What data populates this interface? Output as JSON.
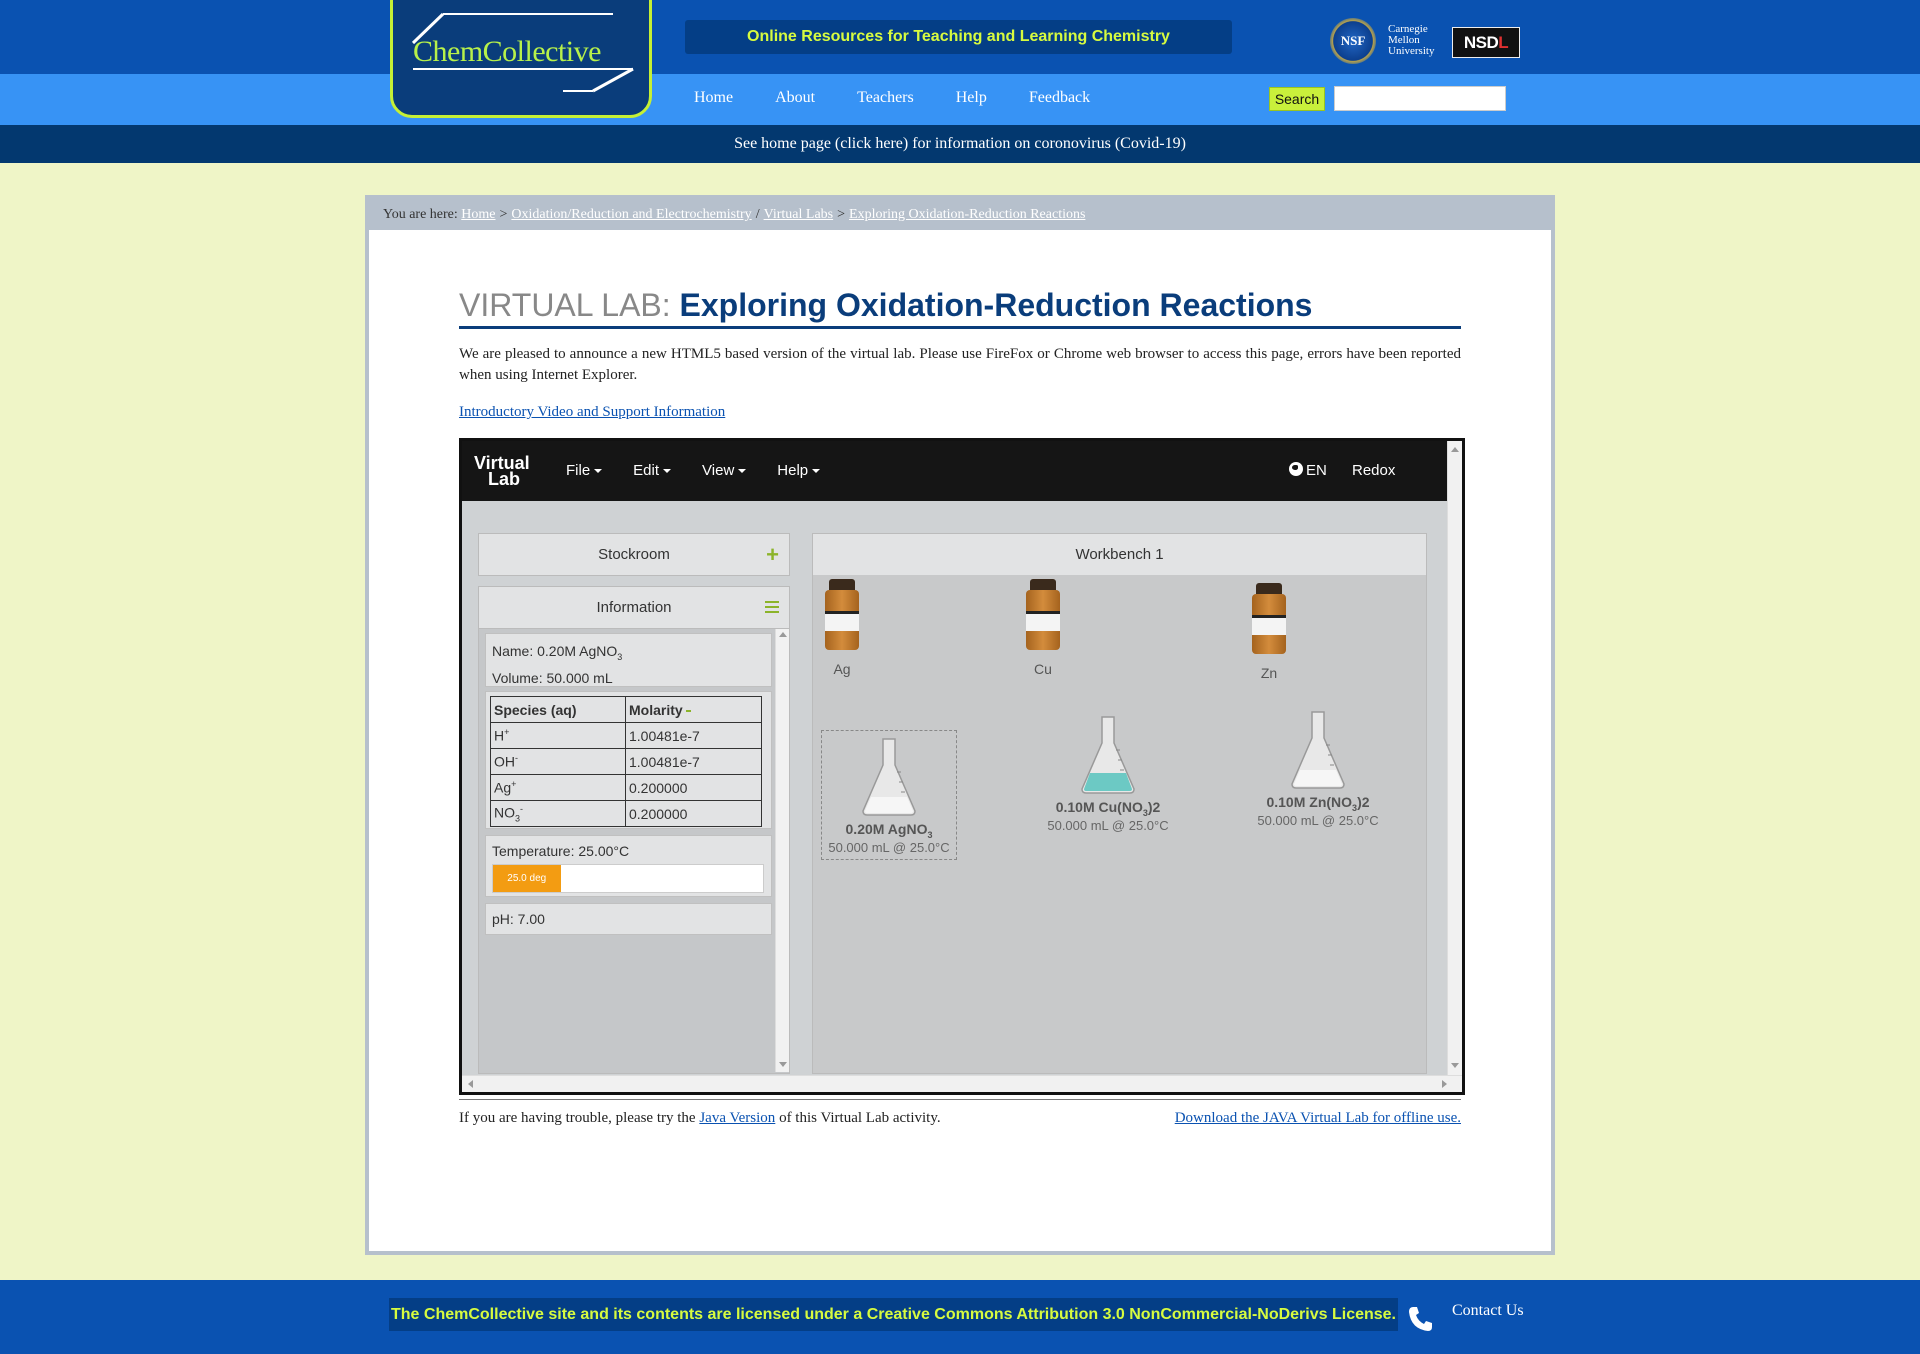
{
  "header": {
    "logo_text": "ChemCollective",
    "tagline": "Online Resources for Teaching and Learning Chemistry",
    "nsf": "NSF",
    "cmu": [
      "Carnegie",
      "Mellon",
      "University"
    ],
    "nsdl_a": "NSD",
    "nsdl_b": "L",
    "nav": [
      "Home",
      "About",
      "Teachers",
      "Help",
      "Feedback"
    ],
    "search_label": "Search",
    "search_placeholder": "",
    "covid_notice": "See home page (click here) for information on coronovirus (Covid-19)"
  },
  "breadcrumb": {
    "prefix": "You are here:",
    "items": [
      "Home",
      "Oxidation/Reduction and Electrochemistry",
      "Virtual Labs",
      "Exploring Oxidation-Reduction Reactions"
    ],
    "separators": [
      ">",
      "/",
      ">"
    ]
  },
  "page": {
    "title_prefix": "VIRTUAL LAB:",
    "title_main": "Exploring Oxidation-Reduction Reactions",
    "intro": "We are pleased to announce a new HTML5 based version of the virtual lab. Please use FireFox or Chrome web browser to access this page, errors have been reported when using Internet Explorer.",
    "video_link": "Introductory Video and Support Information"
  },
  "vlab": {
    "logo_1": "Virtual",
    "logo_2": "Lab",
    "menu": [
      "File",
      "Edit",
      "View",
      "Help"
    ],
    "language": "EN",
    "mode": "Redox",
    "stockroom": "Stockroom",
    "information": "Information",
    "info": {
      "name_label": "Name: 0.20M AgNO",
      "name_sub": "3",
      "volume": "Volume: 50.000 mL",
      "table_headers": [
        "Species (aq)",
        "Molarity"
      ],
      "rows": [
        {
          "base": "H",
          "sup": "+",
          "sub": "",
          "value": "1.00481e-7"
        },
        {
          "base": "OH",
          "sup": "-",
          "sub": "",
          "value": "1.00481e-7"
        },
        {
          "base": "Ag",
          "sup": "+",
          "sub": "",
          "value": "0.200000"
        },
        {
          "base": "NO",
          "sup": "-",
          "sub": "3",
          "value": "0.200000"
        }
      ],
      "temperature": "Temperature: 25.00°C",
      "temp_bar_label": "25.0 deg",
      "temp_fraction": 0.25,
      "ph": "pH: 7.00"
    },
    "workbench": "Workbench 1",
    "bottles": [
      "Ag",
      "Cu",
      "Zn"
    ],
    "flasks": [
      {
        "name": "0.20M AgNO",
        "sub": "3",
        "tail": "",
        "info": "50.000 mL @ 25.0°C",
        "liquid": "#f6f6f6"
      },
      {
        "name": "0.10M Cu(NO",
        "sub": "3",
        "tail": ")2",
        "info": "50.000 mL @ 25.0°C",
        "liquid": "#6cc9c4"
      },
      {
        "name": "0.10M Zn(NO",
        "sub": "3",
        "tail": ")2",
        "info": "50.000 mL @ 25.0°C",
        "liquid": "#f6f6f6"
      }
    ]
  },
  "footer": {
    "trouble_prefix": "If you are having trouble, please try the",
    "java_link": "Java Version",
    "trouble_suffix": "of this Virtual Lab activity.",
    "download_link": "Download the JAVA Virtual Lab for offline use.",
    "license": "The ChemCollective site and its contents are licensed under a Creative Commons Attribution 3.0 NonCommercial-NoDerivs License.",
    "contact": "Contact Us"
  },
  "colors": {
    "topbar": "#0a52b1",
    "navbar": "#3793f5",
    "accent": "#c9f03b",
    "title": "#0a3d7b",
    "temp_fill": "#f39c12"
  }
}
